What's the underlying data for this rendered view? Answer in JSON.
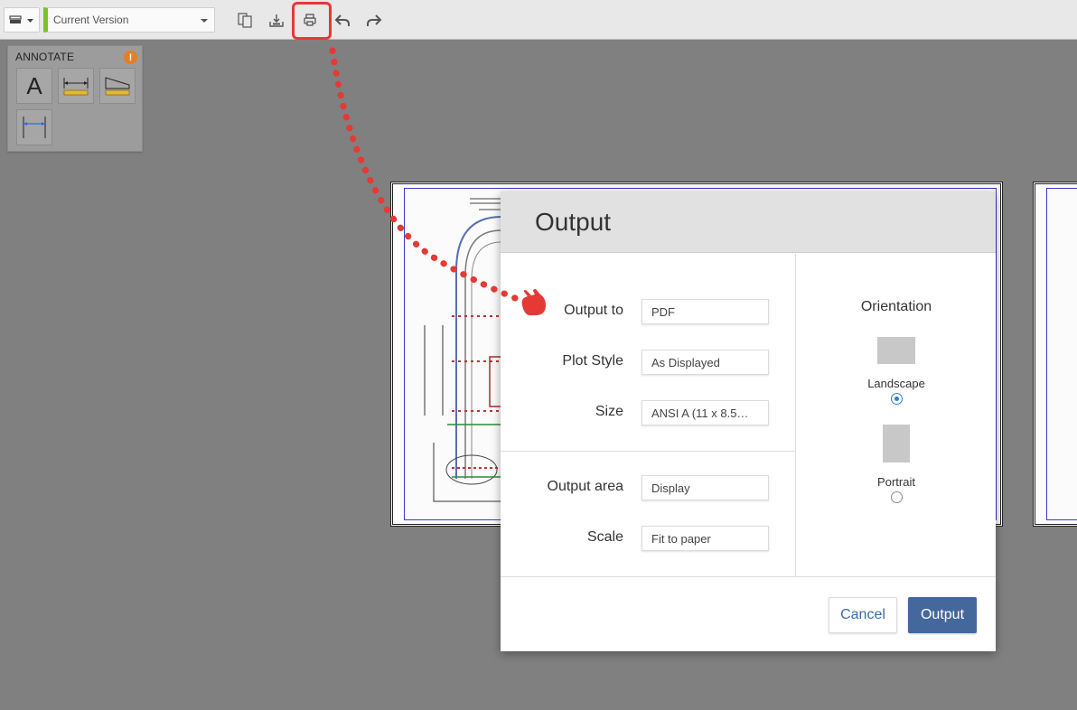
{
  "toolbar": {
    "version_label": "Current Version",
    "icons": [
      "layers-icon",
      "compare-icon",
      "upload-icon",
      "print-icon",
      "undo-icon",
      "redo-icon"
    ]
  },
  "annotate_panel": {
    "title": "ANNOTATE",
    "warning_badge": "!",
    "tools": [
      "text-tool-icon",
      "linear-dimension-icon",
      "area-measure-icon",
      "aligned-dimension-icon"
    ],
    "text_tool_glyph": "A"
  },
  "dialog": {
    "title": "Output",
    "rows": {
      "output_to": {
        "label": "Output to",
        "value": "PDF"
      },
      "plot_style": {
        "label": "Plot Style",
        "value": "As Displayed"
      },
      "size": {
        "label": "Size",
        "value": "ANSI A (11 x 8.5…"
      },
      "output_area": {
        "label": "Output area",
        "value": "Display"
      },
      "scale": {
        "label": "Scale",
        "value": "Fit to paper"
      }
    },
    "orientation": {
      "title": "Orientation",
      "landscape": "Landscape",
      "portrait": "Portrait",
      "selected": "Landscape"
    },
    "cancel_label": "Cancel",
    "output_label": "Output"
  },
  "colors": {
    "accent": "#44689c",
    "highlight": "#e53935",
    "version_bar": "#7cc02d",
    "warning": "#e67e22",
    "radio_selected": "#2f7be0"
  }
}
